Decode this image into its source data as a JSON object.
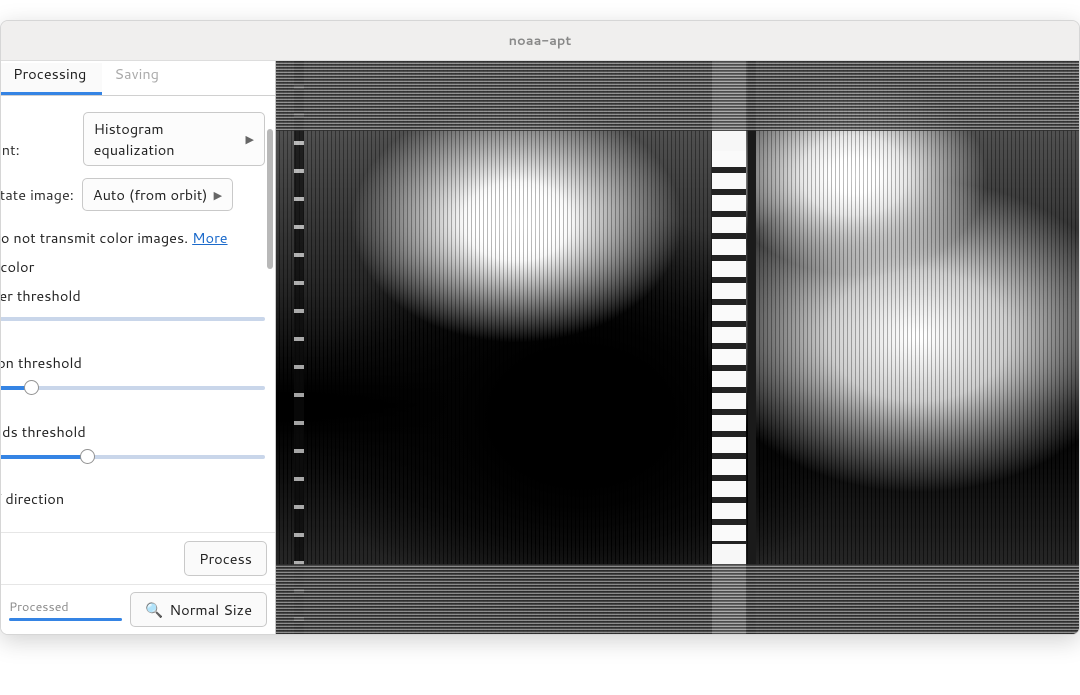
{
  "title": "noaa-apt",
  "tabs": {
    "active": "Processing",
    "inactive": "Saving"
  },
  "panel": {
    "contrast_label": "Contrast adjustment:",
    "contrast_value": "Histogram equalization",
    "rotate_label": "Rotate image:",
    "rotate_value": "Auto (from orbit)",
    "help_prefix": "NOAA satellites do not transmit color images. ",
    "help_link": "More",
    "opt_false_color": "False color",
    "opt_water_thresh": "Water threshold",
    "slider_vegetation": "Vegetation threshold",
    "slider_clouds": "Clouds threshold",
    "slider_val_veg": 13,
    "slider_val_clouds": 34,
    "section_overlay": "Map overlay / direction"
  },
  "footer": {
    "process": "Process",
    "status": "Processed",
    "normal_size": "Normal Size"
  }
}
